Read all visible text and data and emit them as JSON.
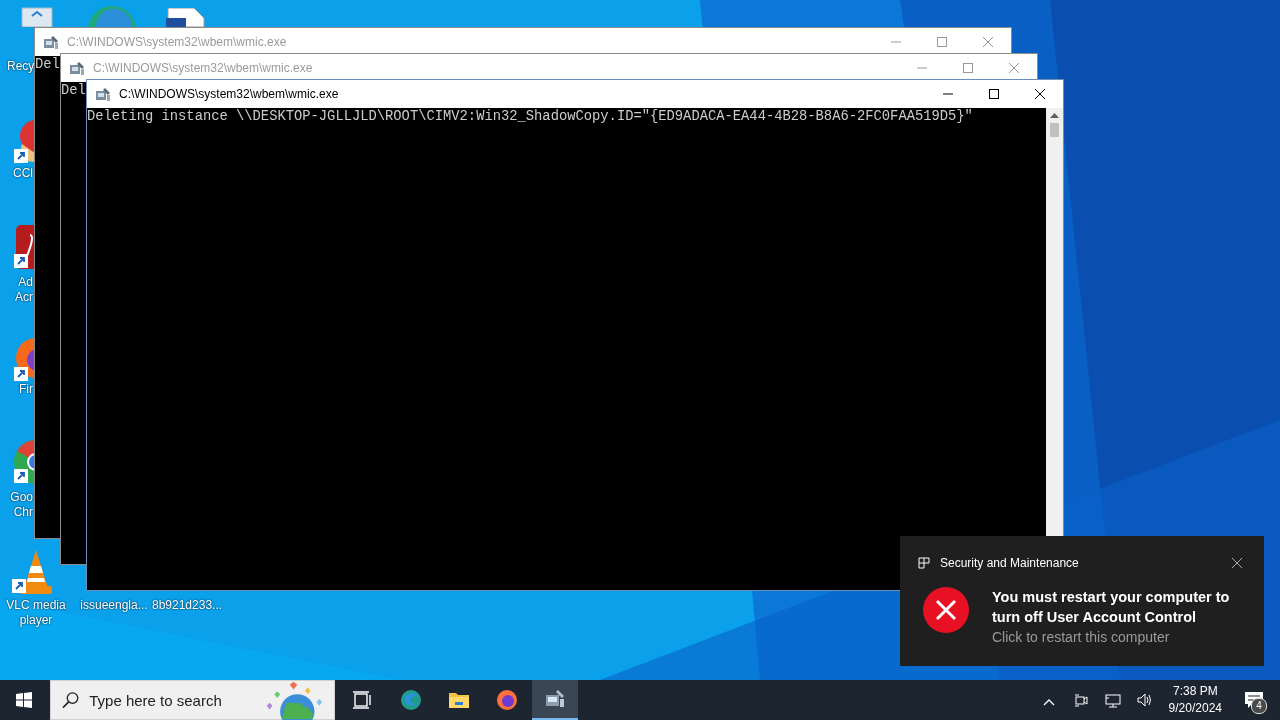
{
  "desktop_icons": [
    {
      "kind": "recycle",
      "label": "Recy"
    },
    {
      "kind": "edge"
    },
    {
      "kind": "document"
    },
    {
      "kind": "cleaner",
      "label": "CCl"
    },
    {
      "kind": "acrobat",
      "label": "Ad Acr"
    },
    {
      "kind": "firefox",
      "label": "Fir"
    },
    {
      "kind": "chrome",
      "label": "Goo Chr"
    },
    {
      "kind": "vlc",
      "label": "VLC media player"
    },
    {
      "kind": "file",
      "label": "issueengla..."
    },
    {
      "kind": "file",
      "label": "8b921d233..."
    }
  ],
  "windows": [
    {
      "title": "C:\\WINDOWS\\system32\\wbem\\wmic.exe",
      "active": false,
      "lines": [
        "Del"
      ]
    },
    {
      "title": "C:\\WINDOWS\\system32\\wbem\\wmic.exe",
      "active": false,
      "lines": [
        "Del"
      ]
    },
    {
      "title": "C:\\WINDOWS\\system32\\wbem\\wmic.exe",
      "active": true,
      "lines": [
        "Deleting instance \\\\DESKTOP-JGLLJLD\\ROOT\\CIMV2:Win32_ShadowCopy.ID=\"{ED9ADACA-EA44-4B28-B8A6-2FC0FAA519D5}\""
      ]
    }
  ],
  "notification": {
    "source": "Security and Maintenance",
    "title": "You must restart your computer to turn off User Account Control",
    "body": "Click to restart this computer"
  },
  "taskbar": {
    "search": {
      "placeholder": "Type here to search"
    },
    "apps": [
      {
        "kind": "taskview",
        "selected": false
      },
      {
        "kind": "edge",
        "selected": false
      },
      {
        "kind": "explorer",
        "selected": false
      },
      {
        "kind": "firefox",
        "selected": false
      },
      {
        "kind": "wmic",
        "selected": true
      }
    ],
    "clock": {
      "time": "7:38 PM",
      "date": "9/20/2024"
    },
    "notifications": {
      "count": "4"
    }
  }
}
